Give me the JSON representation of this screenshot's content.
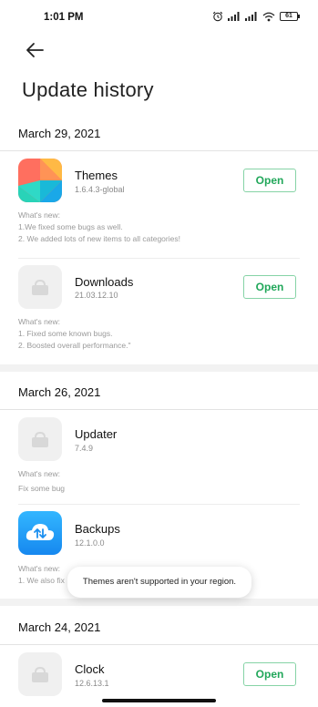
{
  "status_bar": {
    "time": "1:01 PM",
    "battery": "61"
  },
  "header": {
    "title": "Update history"
  },
  "sections": [
    {
      "date": "March 29, 2021",
      "apps": [
        {
          "name": "Themes",
          "version": "1.6.4.3-global",
          "open_label": "Open",
          "whats_new": "What's new:",
          "notes": [
            "1.We fixed some bugs as well.",
            "2. We added lots of new items to all categories!"
          ]
        },
        {
          "name": "Downloads",
          "version": "21.03.12.10",
          "open_label": "Open",
          "whats_new": "What's new:",
          "notes": [
            "1. Fixed some known bugs.",
            "2. Boosted overall performance.\""
          ]
        }
      ]
    },
    {
      "date": "March 26, 2021",
      "apps": [
        {
          "name": "Updater",
          "version": "7.4.9",
          "whats_new": "What's new:",
          "notes": [
            "Fix some bug"
          ]
        },
        {
          "name": "Backups",
          "version": "12.1.0.0",
          "whats_new": "What's new:",
          "notes": [
            "1. We also fix"
          ]
        }
      ]
    },
    {
      "date": "March 24, 2021",
      "apps": [
        {
          "name": "Clock",
          "version": "12.6.13.1",
          "open_label": "Open"
        }
      ]
    }
  ],
  "toast": "Themes aren't supported in your region.",
  "colors": {
    "accent_green": "#21a75a",
    "button_border": "#86d3a6"
  },
  "icons": [
    "back-arrow-icon",
    "alarm-icon",
    "signal-icon",
    "wifi-icon",
    "battery-icon",
    "themes-app-icon",
    "placeholder-app-icon",
    "backups-app-icon"
  ]
}
